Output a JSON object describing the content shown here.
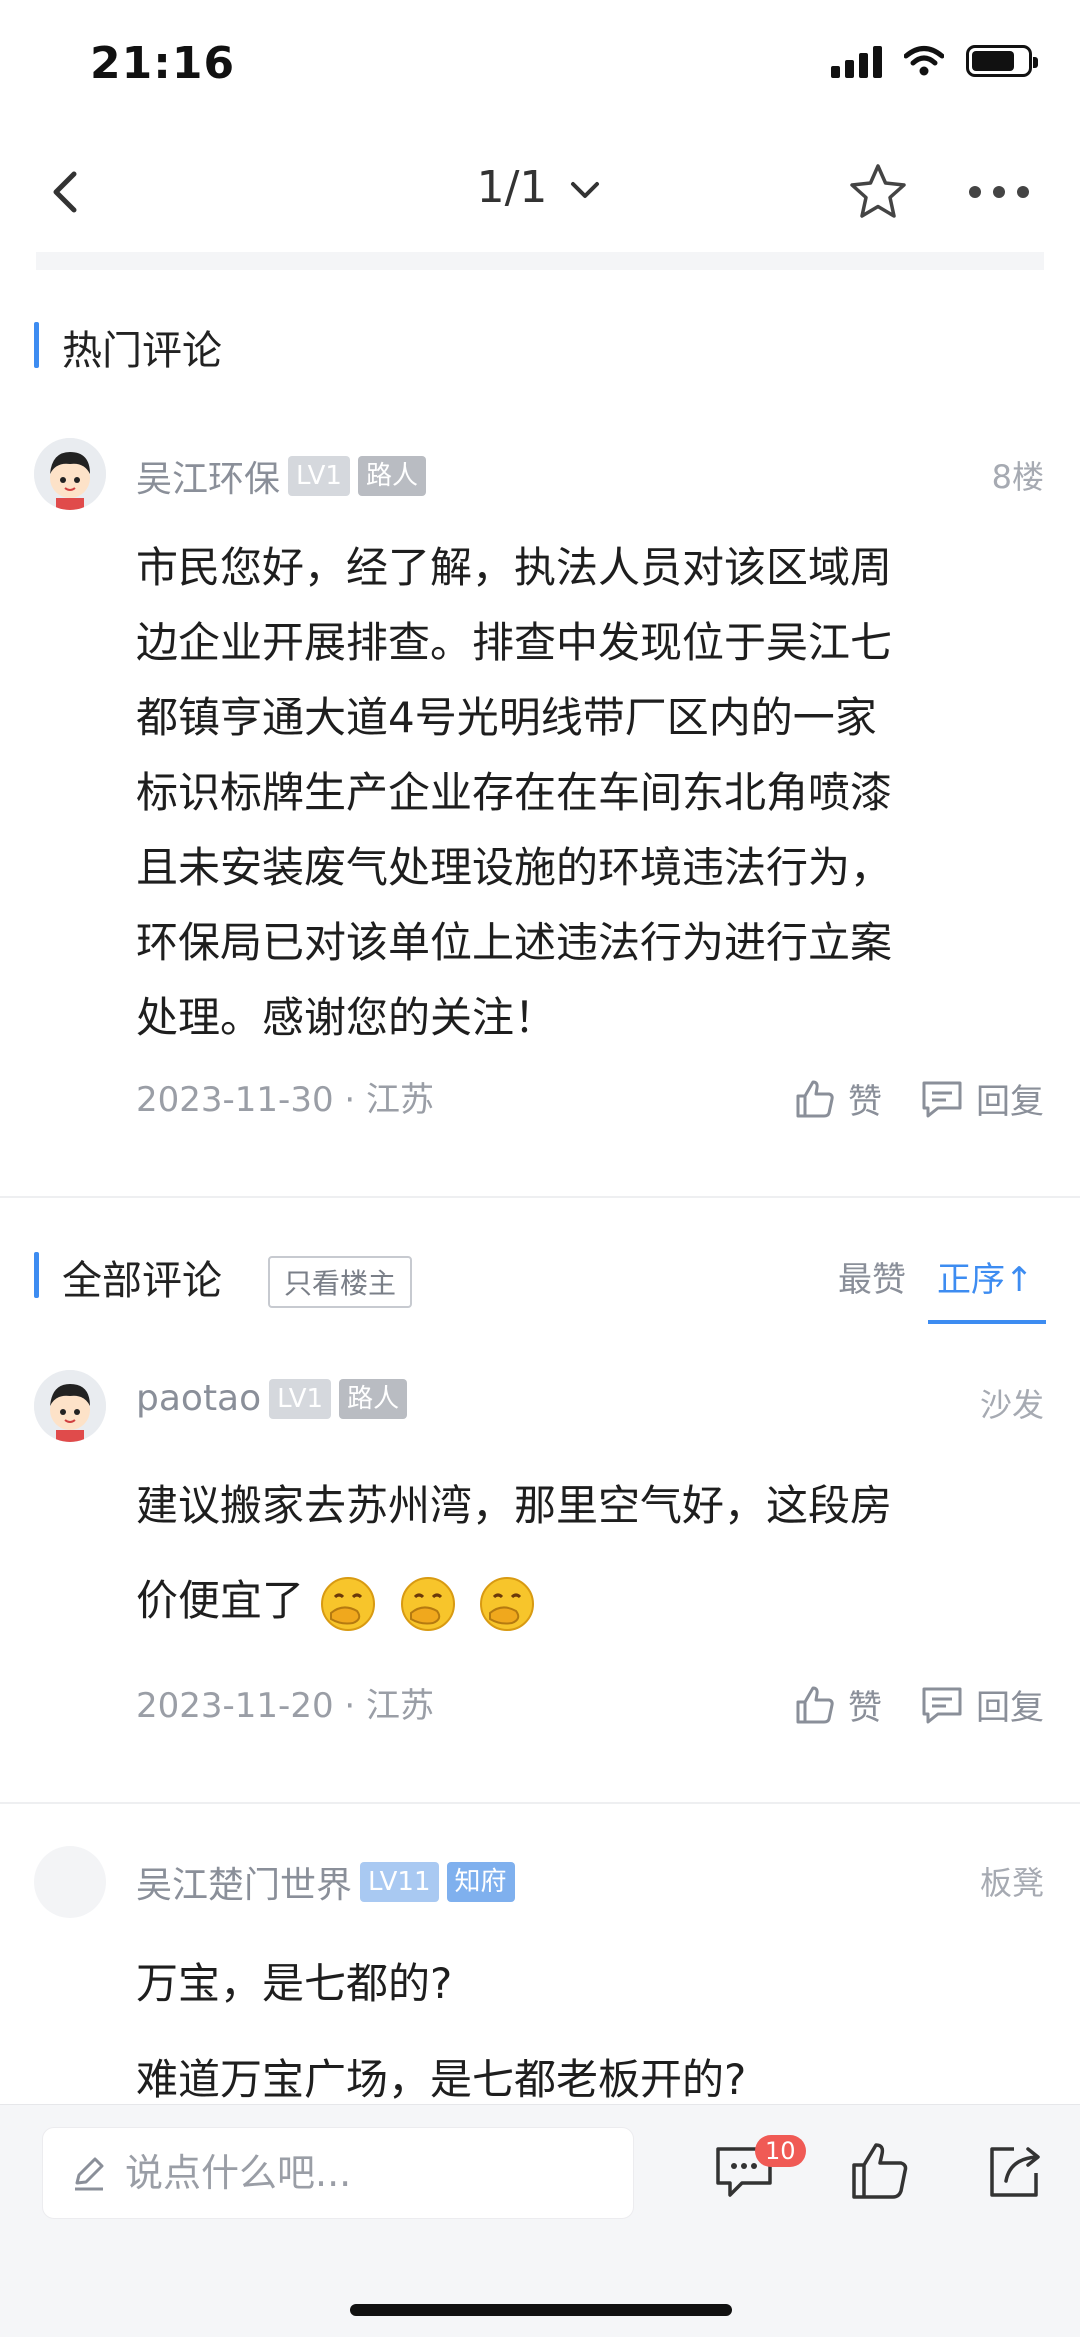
{
  "status": {
    "time": "21:16"
  },
  "nav": {
    "page_indicator": "1/1"
  },
  "hot": {
    "section_title": "热门评论",
    "comment": {
      "username": "吴江环保",
      "level": "LV1",
      "role": "路人",
      "floor": "8楼",
      "lines": [
        "市民您好，经了解，执法人员对该区域周",
        "边企业开展排查。排查中发现位于吴江七",
        "都镇亨通大道4号光明线带厂区内的一家",
        "标识标牌生产企业存在在车间东北角喷漆",
        "且未安装废气处理设施的环境违法行为，",
        "环保局已对该单位上述违法行为进行立案",
        "处理。感谢您的关注！"
      ],
      "date": "2023-11-30",
      "location": "江苏",
      "like_label": "赞",
      "reply_label": "回复"
    }
  },
  "all": {
    "section_title": "全部评论",
    "filter_label": "只看楼主",
    "sort_hot": "最赞",
    "sort_asc": "正序",
    "sort_arrow": "↑",
    "comments": [
      {
        "username": "paotao",
        "level": "LV1",
        "role": "路人",
        "floor": "沙发",
        "line1": "建议搬家去苏州湾，那里空气好，这段房",
        "line2": "价便宜了",
        "emoji": "face-with-hand-over-mouth",
        "date": "2023-11-20",
        "location": "江苏",
        "like_label": "赞",
        "reply_label": "回复"
      },
      {
        "username": "吴江楚门世界",
        "level": "LV11",
        "role": "知府",
        "floor": "板凳",
        "line1": "万宝，是七都的?",
        "line2": "难道万宝广场，是七都老板开的?"
      }
    ]
  },
  "bottom": {
    "input_placeholder": "说点什么吧...",
    "comment_count": "10"
  },
  "colors": {
    "accent": "#3d8cf1",
    "badge_red": "#f05a55"
  }
}
